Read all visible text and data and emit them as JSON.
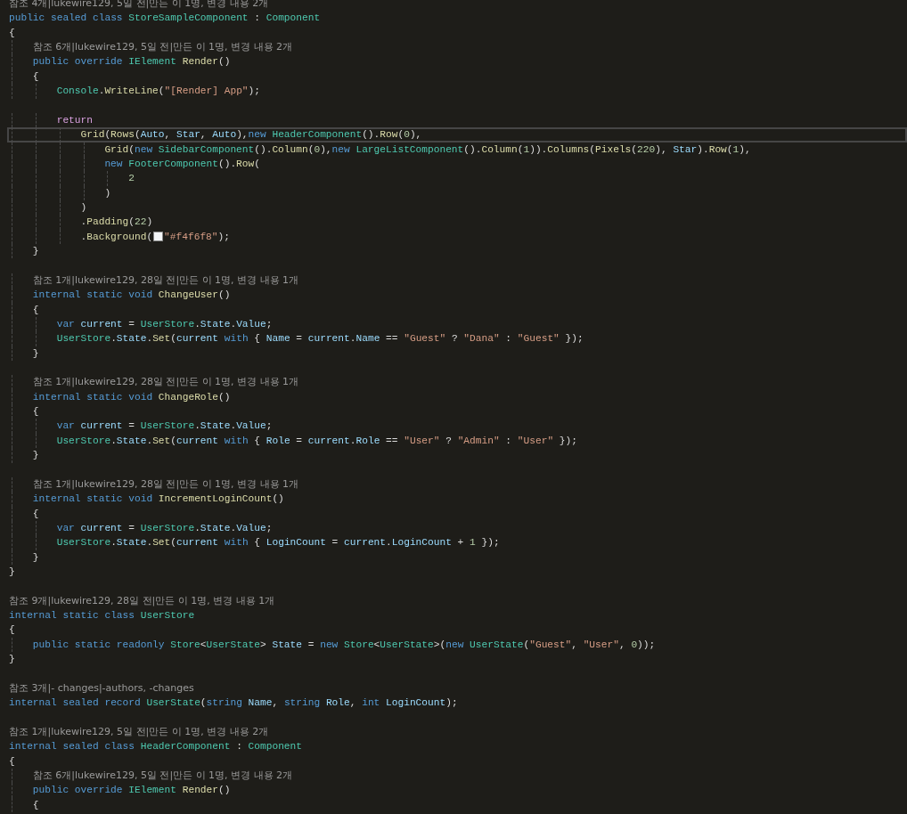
{
  "editor": {
    "lines": [
      {
        "kind": "lens",
        "text": "참조 4개|lukewire129, 5일 전|만든 이 1명, 변경 내용 2개"
      },
      {
        "kind": "code",
        "tokens": [
          {
            "kind": "kw",
            "text": "public sealed class "
          },
          {
            "kind": "ty",
            "text": "StoreSampleComponent"
          },
          {
            "kind": "p",
            "text": " : "
          },
          {
            "kind": "ty",
            "text": "Component"
          }
        ]
      },
      {
        "kind": "code",
        "tokens": [
          {
            "kind": "p",
            "text": "{"
          }
        ],
        "children": [
          {
            "kind": "lens",
            "text": "참조 6개|lukewire129, 5일 전|만든 이 1명, 변경 내용 2개"
          },
          {
            "kind": "code",
            "tokens": [
              {
                "kind": "kw",
                "text": "public override "
              },
              {
                "kind": "ty",
                "text": "IElement "
              },
              {
                "kind": "fn",
                "text": "Render"
              },
              {
                "kind": "p",
                "text": "()"
              }
            ]
          },
          {
            "kind": "code",
            "tokens": [
              {
                "kind": "p",
                "text": "{"
              }
            ],
            "children": [
              {
                "kind": "code",
                "tokens": [
                  {
                    "kind": "ty",
                    "text": "Console"
                  },
                  {
                    "kind": "p",
                    "text": "."
                  },
                  {
                    "kind": "fn",
                    "text": "WriteLine"
                  },
                  {
                    "kind": "p",
                    "text": "("
                  },
                  {
                    "kind": "str",
                    "text": "\"[Render] App\""
                  },
                  {
                    "kind": "p",
                    "text": ");"
                  }
                ]
              },
              {
                "kind": "blank"
              },
              {
                "kind": "code",
                "tokens": [
                  {
                    "kind": "ctl",
                    "text": "return"
                  }
                ],
                "children": [
                  {
                    "kind": "code",
                    "current": true,
                    "tokens": [
                      {
                        "kind": "fn",
                        "text": "Grid"
                      },
                      {
                        "kind": "p",
                        "text": "("
                      },
                      {
                        "kind": "fn",
                        "text": "Rows"
                      },
                      {
                        "kind": "p",
                        "text": "("
                      },
                      {
                        "kind": "id",
                        "text": "Auto"
                      },
                      {
                        "kind": "p",
                        "text": ", "
                      },
                      {
                        "kind": "id",
                        "text": "Star"
                      },
                      {
                        "kind": "p",
                        "text": ", "
                      },
                      {
                        "kind": "id",
                        "text": "Auto"
                      },
                      {
                        "kind": "p",
                        "text": "),"
                      },
                      {
                        "kind": "kw",
                        "text": "new "
                      },
                      {
                        "kind": "ty",
                        "text": "HeaderComponent"
                      },
                      {
                        "kind": "p",
                        "text": "()."
                      },
                      {
                        "kind": "fn",
                        "text": "Row"
                      },
                      {
                        "kind": "p",
                        "text": "("
                      },
                      {
                        "kind": "num",
                        "text": "0"
                      },
                      {
                        "kind": "p",
                        "text": "),"
                      }
                    ],
                    "children": [
                      {
                        "kind": "code",
                        "tokens": [
                          {
                            "kind": "fn",
                            "text": "Grid"
                          },
                          {
                            "kind": "p",
                            "text": "("
                          },
                          {
                            "kind": "kw",
                            "text": "new "
                          },
                          {
                            "kind": "ty",
                            "text": "SidebarComponent"
                          },
                          {
                            "kind": "p",
                            "text": "()."
                          },
                          {
                            "kind": "fn",
                            "text": "Column"
                          },
                          {
                            "kind": "p",
                            "text": "("
                          },
                          {
                            "kind": "num",
                            "text": "0"
                          },
                          {
                            "kind": "p",
                            "text": "),"
                          },
                          {
                            "kind": "kw",
                            "text": "new "
                          },
                          {
                            "kind": "ty",
                            "text": "LargeListComponent"
                          },
                          {
                            "kind": "p",
                            "text": "()."
                          },
                          {
                            "kind": "fn",
                            "text": "Column"
                          },
                          {
                            "kind": "p",
                            "text": "("
                          },
                          {
                            "kind": "num",
                            "text": "1"
                          },
                          {
                            "kind": "p",
                            "text": "))."
                          },
                          {
                            "kind": "fn",
                            "text": "Columns"
                          },
                          {
                            "kind": "p",
                            "text": "("
                          },
                          {
                            "kind": "fn",
                            "text": "Pixels"
                          },
                          {
                            "kind": "p",
                            "text": "("
                          },
                          {
                            "kind": "num",
                            "text": "220"
                          },
                          {
                            "kind": "p",
                            "text": "), "
                          },
                          {
                            "kind": "id",
                            "text": "Star"
                          },
                          {
                            "kind": "p",
                            "text": ")."
                          },
                          {
                            "kind": "fn",
                            "text": "Row"
                          },
                          {
                            "kind": "p",
                            "text": "("
                          },
                          {
                            "kind": "num",
                            "text": "1"
                          },
                          {
                            "kind": "p",
                            "text": "),"
                          }
                        ]
                      },
                      {
                        "kind": "code",
                        "tokens": [
                          {
                            "kind": "kw",
                            "text": "new "
                          },
                          {
                            "kind": "ty",
                            "text": "FooterComponent"
                          },
                          {
                            "kind": "p",
                            "text": "()."
                          },
                          {
                            "kind": "fn",
                            "text": "Row"
                          },
                          {
                            "kind": "p",
                            "text": "("
                          }
                        ],
                        "children": [
                          {
                            "kind": "code",
                            "tokens": [
                              {
                                "kind": "num",
                                "text": "2"
                              }
                            ]
                          }
                        ]
                      },
                      {
                        "kind": "code",
                        "tokens": [
                          {
                            "kind": "p",
                            "text": ")"
                          }
                        ]
                      }
                    ]
                  },
                  {
                    "kind": "code",
                    "tokens": [
                      {
                        "kind": "p",
                        "text": ")"
                      }
                    ]
                  },
                  {
                    "kind": "code",
                    "tokens": [
                      {
                        "kind": "p",
                        "text": "."
                      },
                      {
                        "kind": "fn",
                        "text": "Padding"
                      },
                      {
                        "kind": "p",
                        "text": "("
                      },
                      {
                        "kind": "num",
                        "text": "22"
                      },
                      {
                        "kind": "p",
                        "text": ")"
                      }
                    ]
                  },
                  {
                    "kind": "code",
                    "tokens": [
                      {
                        "kind": "p",
                        "text": "."
                      },
                      {
                        "kind": "fn",
                        "text": "Background"
                      },
                      {
                        "kind": "p",
                        "text": "("
                      },
                      {
                        "kind": "swatch",
                        "color": "#f4f6f8"
                      },
                      {
                        "kind": "str",
                        "text": "\"#f4f6f8\""
                      },
                      {
                        "kind": "p",
                        "text": ");"
                      }
                    ]
                  }
                ]
              }
            ]
          },
          {
            "kind": "code",
            "tokens": [
              {
                "kind": "p",
                "text": "}"
              }
            ]
          },
          {
            "kind": "blank"
          },
          {
            "kind": "lens",
            "text": "참조 1개|lukewire129, 28일 전|만든 이 1명, 변경 내용 1개"
          },
          {
            "kind": "code",
            "tokens": [
              {
                "kind": "kw",
                "text": "internal static void "
              },
              {
                "kind": "fn",
                "text": "ChangeUser"
              },
              {
                "kind": "p",
                "text": "()"
              }
            ]
          },
          {
            "kind": "code",
            "tokens": [
              {
                "kind": "p",
                "text": "{"
              }
            ],
            "children": [
              {
                "kind": "code",
                "tokens": [
                  {
                    "kind": "kw",
                    "text": "var "
                  },
                  {
                    "kind": "id",
                    "text": "current"
                  },
                  {
                    "kind": "p",
                    "text": " = "
                  },
                  {
                    "kind": "ty",
                    "text": "UserStore"
                  },
                  {
                    "kind": "p",
                    "text": "."
                  },
                  {
                    "kind": "id",
                    "text": "State"
                  },
                  {
                    "kind": "p",
                    "text": "."
                  },
                  {
                    "kind": "id",
                    "text": "Value"
                  },
                  {
                    "kind": "p",
                    "text": ";"
                  }
                ]
              },
              {
                "kind": "code",
                "tokens": [
                  {
                    "kind": "ty",
                    "text": "UserStore"
                  },
                  {
                    "kind": "p",
                    "text": "."
                  },
                  {
                    "kind": "id",
                    "text": "State"
                  },
                  {
                    "kind": "p",
                    "text": "."
                  },
                  {
                    "kind": "fn",
                    "text": "Set"
                  },
                  {
                    "kind": "p",
                    "text": "("
                  },
                  {
                    "kind": "id",
                    "text": "current "
                  },
                  {
                    "kind": "kw",
                    "text": "with"
                  },
                  {
                    "kind": "p",
                    "text": " { "
                  },
                  {
                    "kind": "id",
                    "text": "Name"
                  },
                  {
                    "kind": "p",
                    "text": " = "
                  },
                  {
                    "kind": "id",
                    "text": "current"
                  },
                  {
                    "kind": "p",
                    "text": "."
                  },
                  {
                    "kind": "id",
                    "text": "Name"
                  },
                  {
                    "kind": "p",
                    "text": " == "
                  },
                  {
                    "kind": "str",
                    "text": "\"Guest\""
                  },
                  {
                    "kind": "p",
                    "text": " ? "
                  },
                  {
                    "kind": "str",
                    "text": "\"Dana\""
                  },
                  {
                    "kind": "p",
                    "text": " : "
                  },
                  {
                    "kind": "str",
                    "text": "\"Guest\""
                  },
                  {
                    "kind": "p",
                    "text": " });"
                  }
                ]
              }
            ]
          },
          {
            "kind": "code",
            "tokens": [
              {
                "kind": "p",
                "text": "}"
              }
            ]
          },
          {
            "kind": "blank"
          },
          {
            "kind": "lens",
            "text": "참조 1개|lukewire129, 28일 전|만든 이 1명, 변경 내용 1개"
          },
          {
            "kind": "code",
            "tokens": [
              {
                "kind": "kw",
                "text": "internal static void "
              },
              {
                "kind": "fn",
                "text": "ChangeRole"
              },
              {
                "kind": "p",
                "text": "()"
              }
            ]
          },
          {
            "kind": "code",
            "tokens": [
              {
                "kind": "p",
                "text": "{"
              }
            ],
            "children": [
              {
                "kind": "code",
                "tokens": [
                  {
                    "kind": "kw",
                    "text": "var "
                  },
                  {
                    "kind": "id",
                    "text": "current"
                  },
                  {
                    "kind": "p",
                    "text": " = "
                  },
                  {
                    "kind": "ty",
                    "text": "UserStore"
                  },
                  {
                    "kind": "p",
                    "text": "."
                  },
                  {
                    "kind": "id",
                    "text": "State"
                  },
                  {
                    "kind": "p",
                    "text": "."
                  },
                  {
                    "kind": "id",
                    "text": "Value"
                  },
                  {
                    "kind": "p",
                    "text": ";"
                  }
                ]
              },
              {
                "kind": "code",
                "tokens": [
                  {
                    "kind": "ty",
                    "text": "UserStore"
                  },
                  {
                    "kind": "p",
                    "text": "."
                  },
                  {
                    "kind": "id",
                    "text": "State"
                  },
                  {
                    "kind": "p",
                    "text": "."
                  },
                  {
                    "kind": "fn",
                    "text": "Set"
                  },
                  {
                    "kind": "p",
                    "text": "("
                  },
                  {
                    "kind": "id",
                    "text": "current "
                  },
                  {
                    "kind": "kw",
                    "text": "with"
                  },
                  {
                    "kind": "p",
                    "text": " { "
                  },
                  {
                    "kind": "id",
                    "text": "Role"
                  },
                  {
                    "kind": "p",
                    "text": " = "
                  },
                  {
                    "kind": "id",
                    "text": "current"
                  },
                  {
                    "kind": "p",
                    "text": "."
                  },
                  {
                    "kind": "id",
                    "text": "Role"
                  },
                  {
                    "kind": "p",
                    "text": " == "
                  },
                  {
                    "kind": "str",
                    "text": "\"User\""
                  },
                  {
                    "kind": "p",
                    "text": " ? "
                  },
                  {
                    "kind": "str",
                    "text": "\"Admin\""
                  },
                  {
                    "kind": "p",
                    "text": " : "
                  },
                  {
                    "kind": "str",
                    "text": "\"User\""
                  },
                  {
                    "kind": "p",
                    "text": " });"
                  }
                ]
              }
            ]
          },
          {
            "kind": "code",
            "tokens": [
              {
                "kind": "p",
                "text": "}"
              }
            ]
          },
          {
            "kind": "blank"
          },
          {
            "kind": "lens",
            "text": "참조 1개|lukewire129, 28일 전|만든 이 1명, 변경 내용 1개"
          },
          {
            "kind": "code",
            "tokens": [
              {
                "kind": "kw",
                "text": "internal static void "
              },
              {
                "kind": "fn",
                "text": "IncrementLoginCount"
              },
              {
                "kind": "p",
                "text": "()"
              }
            ]
          },
          {
            "kind": "code",
            "tokens": [
              {
                "kind": "p",
                "text": "{"
              }
            ],
            "children": [
              {
                "kind": "code",
                "tokens": [
                  {
                    "kind": "kw",
                    "text": "var "
                  },
                  {
                    "kind": "id",
                    "text": "current"
                  },
                  {
                    "kind": "p",
                    "text": " = "
                  },
                  {
                    "kind": "ty",
                    "text": "UserStore"
                  },
                  {
                    "kind": "p",
                    "text": "."
                  },
                  {
                    "kind": "id",
                    "text": "State"
                  },
                  {
                    "kind": "p",
                    "text": "."
                  },
                  {
                    "kind": "id",
                    "text": "Value"
                  },
                  {
                    "kind": "p",
                    "text": ";"
                  }
                ]
              },
              {
                "kind": "code",
                "tokens": [
                  {
                    "kind": "ty",
                    "text": "UserStore"
                  },
                  {
                    "kind": "p",
                    "text": "."
                  },
                  {
                    "kind": "id",
                    "text": "State"
                  },
                  {
                    "kind": "p",
                    "text": "."
                  },
                  {
                    "kind": "fn",
                    "text": "Set"
                  },
                  {
                    "kind": "p",
                    "text": "("
                  },
                  {
                    "kind": "id",
                    "text": "current "
                  },
                  {
                    "kind": "kw",
                    "text": "with"
                  },
                  {
                    "kind": "p",
                    "text": " { "
                  },
                  {
                    "kind": "id",
                    "text": "LoginCount"
                  },
                  {
                    "kind": "p",
                    "text": " = "
                  },
                  {
                    "kind": "id",
                    "text": "current"
                  },
                  {
                    "kind": "p",
                    "text": "."
                  },
                  {
                    "kind": "id",
                    "text": "LoginCount"
                  },
                  {
                    "kind": "p",
                    "text": " + "
                  },
                  {
                    "kind": "num",
                    "text": "1"
                  },
                  {
                    "kind": "p",
                    "text": " });"
                  }
                ]
              }
            ]
          },
          {
            "kind": "code",
            "tokens": [
              {
                "kind": "p",
                "text": "}"
              }
            ]
          }
        ]
      },
      {
        "kind": "code",
        "tokens": [
          {
            "kind": "p",
            "text": "}"
          }
        ]
      },
      {
        "kind": "blank"
      },
      {
        "kind": "lens",
        "text": "참조 9개|lukewire129, 28일 전|만든 이 1명, 변경 내용 1개"
      },
      {
        "kind": "code",
        "tokens": [
          {
            "kind": "kw",
            "text": "internal static class "
          },
          {
            "kind": "ty",
            "text": "UserStore"
          }
        ]
      },
      {
        "kind": "code",
        "tokens": [
          {
            "kind": "p",
            "text": "{"
          }
        ],
        "children": [
          {
            "kind": "code",
            "tokens": [
              {
                "kind": "kw",
                "text": "public static readonly "
              },
              {
                "kind": "ty",
                "text": "Store"
              },
              {
                "kind": "p",
                "text": "<"
              },
              {
                "kind": "ty",
                "text": "UserState"
              },
              {
                "kind": "p",
                "text": "> "
              },
              {
                "kind": "id",
                "text": "State"
              },
              {
                "kind": "p",
                "text": " = "
              },
              {
                "kind": "kw",
                "text": "new "
              },
              {
                "kind": "ty",
                "text": "Store"
              },
              {
                "kind": "p",
                "text": "<"
              },
              {
                "kind": "ty",
                "text": "UserState"
              },
              {
                "kind": "p",
                "text": ">("
              },
              {
                "kind": "kw",
                "text": "new "
              },
              {
                "kind": "ty",
                "text": "UserState"
              },
              {
                "kind": "p",
                "text": "("
              },
              {
                "kind": "str",
                "text": "\"Guest\""
              },
              {
                "kind": "p",
                "text": ", "
              },
              {
                "kind": "str",
                "text": "\"User\""
              },
              {
                "kind": "p",
                "text": ", "
              },
              {
                "kind": "num",
                "text": "0"
              },
              {
                "kind": "p",
                "text": "));"
              }
            ]
          }
        ]
      },
      {
        "kind": "code",
        "tokens": [
          {
            "kind": "p",
            "text": "}"
          }
        ]
      },
      {
        "kind": "blank"
      },
      {
        "kind": "lens",
        "text": "참조 3개|- changes|-authors, -changes"
      },
      {
        "kind": "code",
        "tokens": [
          {
            "kind": "kw",
            "text": "internal sealed record "
          },
          {
            "kind": "ty",
            "text": "UserState"
          },
          {
            "kind": "p",
            "text": "("
          },
          {
            "kind": "kw",
            "text": "string "
          },
          {
            "kind": "id",
            "text": "Name"
          },
          {
            "kind": "p",
            "text": ", "
          },
          {
            "kind": "kw",
            "text": "string "
          },
          {
            "kind": "id",
            "text": "Role"
          },
          {
            "kind": "p",
            "text": ", "
          },
          {
            "kind": "kw",
            "text": "int "
          },
          {
            "kind": "id",
            "text": "LoginCount"
          },
          {
            "kind": "p",
            "text": ");"
          }
        ]
      },
      {
        "kind": "blank"
      },
      {
        "kind": "lens",
        "text": "참조 1개|lukewire129, 5일 전|만든 이 1명, 변경 내용 2개"
      },
      {
        "kind": "code",
        "tokens": [
          {
            "kind": "kw",
            "text": "internal sealed class "
          },
          {
            "kind": "ty",
            "text": "HeaderComponent"
          },
          {
            "kind": "p",
            "text": " : "
          },
          {
            "kind": "ty",
            "text": "Component"
          }
        ]
      },
      {
        "kind": "code",
        "tokens": [
          {
            "kind": "p",
            "text": "{"
          }
        ],
        "children": [
          {
            "kind": "lens",
            "text": "참조 6개|lukewire129, 5일 전|만든 이 1명, 변경 내용 2개"
          },
          {
            "kind": "code",
            "tokens": [
              {
                "kind": "kw",
                "text": "public override "
              },
              {
                "kind": "ty",
                "text": "IElement "
              },
              {
                "kind": "fn",
                "text": "Render"
              },
              {
                "kind": "p",
                "text": "()"
              }
            ]
          },
          {
            "kind": "code",
            "tokens": [
              {
                "kind": "p",
                "text": "{"
              }
            ]
          }
        ]
      }
    ]
  }
}
